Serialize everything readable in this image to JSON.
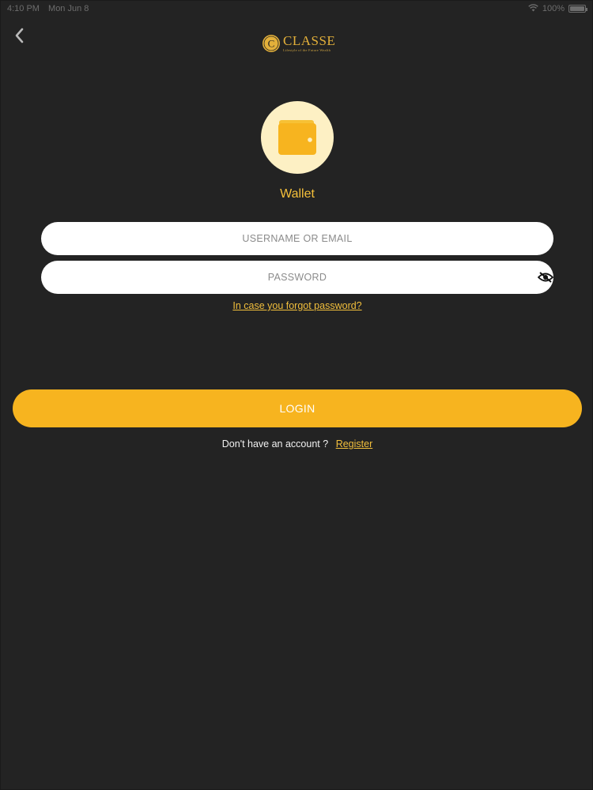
{
  "status_bar": {
    "time": "4:10 PM",
    "date": "Mon Jun 8",
    "battery": "100%",
    "battery_level": 1.0
  },
  "header": {
    "logo_title": "CLASSE",
    "logo_subtitle": "Lifestyle of the Future Wealth",
    "logo_letter": "C"
  },
  "wallet": {
    "title": "Wallet",
    "icon": "wallet-icon"
  },
  "form": {
    "username_placeholder": "USERNAME OR EMAIL",
    "password_placeholder": "PASSWORD",
    "forgot_password": "In case you forgot password?",
    "login_label": "LOGIN",
    "no_account_text": "Don't have an account ?",
    "register_label": "Register"
  },
  "colors": {
    "background": "#232323",
    "accent": "#f7b41f",
    "link": "#f2bf3c",
    "wallet_circle": "#fdf0c4"
  }
}
